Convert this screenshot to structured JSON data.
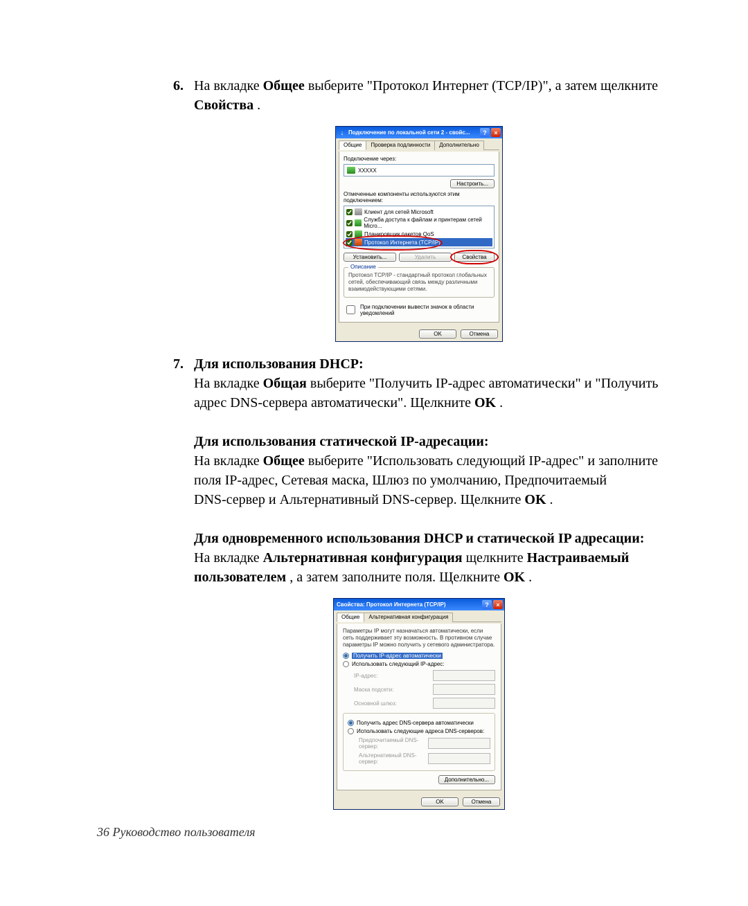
{
  "doc": {
    "step6": {
      "number": "6.",
      "text_before_bold1": "На вкладке ",
      "bold1": "Общее",
      "text_mid": " выберите \"Протокол Интернет (TCP/IP)\", а затем щелкните ",
      "bold2": "Свойства",
      "text_end": "."
    },
    "step7": {
      "number": "7.",
      "dhcp_title": "Для использования DHCP:",
      "dhcp_p1_before": "На вкладке ",
      "dhcp_p1_bold": "Общая",
      "dhcp_p1_mid": " выберите \"Получить IP-адрес автоматически\" и \"Получить адрес DNS-сервера автоматически\". Щелкните ",
      "dhcp_p1_ok": "OK",
      "dhcp_p1_end": ".",
      "static_title": "Для использования статической IP-адресации:",
      "static_p_before": "На вкладке ",
      "static_p_bold": "Общее",
      "static_p_mid": " выберите \"Использовать следующий IP-адрес\" и заполните поля IP-адрес, Сетевая маска, Шлюз по умолчанию, Предпочитаемый",
      "static_p_line2": "DNS-сервер и Альтернативный DNS-сервер. Щелкните ",
      "static_p_ok": "OK",
      "static_p_end": ".",
      "both_title": "Для одновременного использования DHCP и статической IP адресации:",
      "both_p_before": "На вкладке ",
      "both_p_bold1": "Альтернативная конфигурация",
      "both_p_mid1": " щелкните ",
      "both_p_bold2": "Настраиваемый пользователем",
      "both_p_mid2": ", а затем заполните поля. Щелкните ",
      "both_p_ok": "OK",
      "both_p_end": "."
    },
    "footer": "36  Руководство пользователя"
  },
  "dlg1": {
    "title": "Подключение по локальной сети 2 - свойс...",
    "help": "?",
    "close": "×",
    "tabs": [
      "Общие",
      "Проверка подлинности",
      "Дополнительно"
    ],
    "connect_using_label": "Подключение через:",
    "adapter_name": "XXXXX",
    "configure_btn": "Настроить...",
    "components_label": "Отмеченные компоненты используются этим подключением:",
    "items": [
      {
        "label": "Клиент для сетей Microsoft",
        "checked": true,
        "icon": "ic-gray"
      },
      {
        "label": "Служба доступа к файлам и принтерам сетей Micro...",
        "checked": true,
        "icon": "ic-green"
      },
      {
        "label": "Планировщик пакетов QoS",
        "checked": true,
        "icon": "ic-green"
      },
      {
        "label": "Протокол Интернета (TCP/IP)",
        "checked": true,
        "icon": "ic-tcp",
        "selected": true
      }
    ],
    "install_btn": "Установить...",
    "remove_btn": "Удалить",
    "properties_btn": "Свойства",
    "desc_legend": "Описание",
    "desc_text": "Протокол TCP/IP - стандартный протокол глобальных сетей, обеспечивающий связь между различными взаимодействующими сетями.",
    "tray_checkbox": "При подключении вывести значок в области уведомлений",
    "ok": "OK",
    "cancel": "Отмена"
  },
  "dlg2": {
    "title": "Свойства: Протокол Интернета (TCP/IP)",
    "help": "?",
    "close": "×",
    "tabs": [
      "Общие",
      "Альтернативная конфигурация"
    ],
    "intro": "Параметры IP могут назначаться автоматически, если сеть поддерживает эту возможность. В противном случае параметры IP можно получить у сетевого администратора.",
    "radio_ip_auto": "Получить IP-адрес автоматически",
    "radio_ip_manual": "Использовать следующий IP-адрес:",
    "ip_label": "IP-адрес:",
    "mask_label": "Маска подсети:",
    "gw_label": "Основной шлюз:",
    "radio_dns_auto": "Получить адрес DNS-сервера автоматически",
    "radio_dns_manual": "Использовать следующие адреса DNS-серверов:",
    "dns1_label": "Предпочитаемый DNS-сервер:",
    "dns2_label": "Альтернативный DNS-сервер:",
    "advanced_btn": "Дополнительно...",
    "ok": "OK",
    "cancel": "Отмена"
  }
}
